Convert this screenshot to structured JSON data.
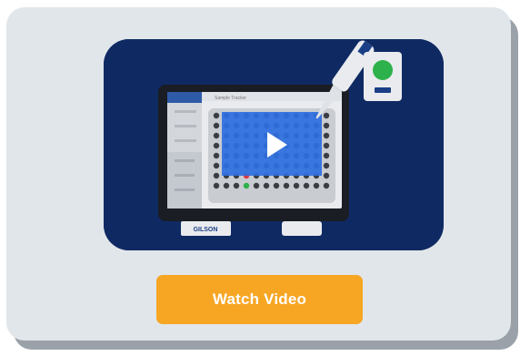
{
  "video_card": {
    "button_label": "Watch Video",
    "thumbnail": {
      "icon": "play-icon",
      "brand_text": "GILSON",
      "screen_title": "Sample Tracker"
    }
  },
  "colors": {
    "card_bg": "#e1e6ea",
    "thumb_bg": "#0f2a63",
    "button": "#f6a623",
    "play_overlay": "#2f6fe0"
  }
}
